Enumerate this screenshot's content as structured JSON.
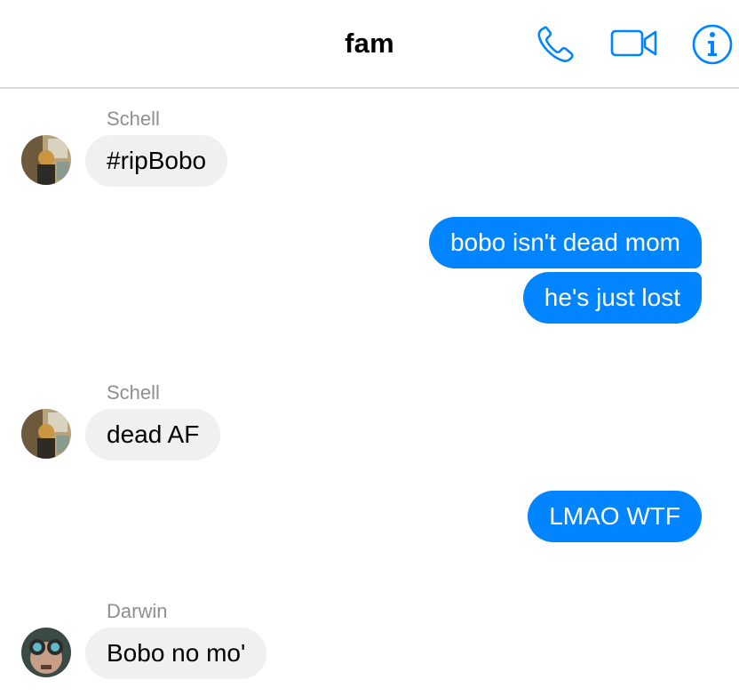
{
  "header": {
    "title": "fam",
    "accent_color": "#0084ff",
    "icons": [
      "phone-icon",
      "video-camera-icon",
      "info-icon"
    ]
  },
  "colors": {
    "outgoing_bubble": "#0084ff",
    "incoming_bubble": "#f1f0f0",
    "sender_name": "#8e8e93"
  },
  "messages": [
    {
      "direction": "incoming",
      "sender": "Schell",
      "text": "#ripBobo"
    },
    {
      "direction": "outgoing",
      "text": "bobo isn't dead mom"
    },
    {
      "direction": "outgoing",
      "text": "he's just lost"
    },
    {
      "direction": "incoming",
      "sender": "Schell",
      "text": "dead AF"
    },
    {
      "direction": "outgoing",
      "text": "LMAO WTF"
    },
    {
      "direction": "incoming",
      "sender": "Darwin",
      "text": "Bobo no mo'"
    }
  ]
}
